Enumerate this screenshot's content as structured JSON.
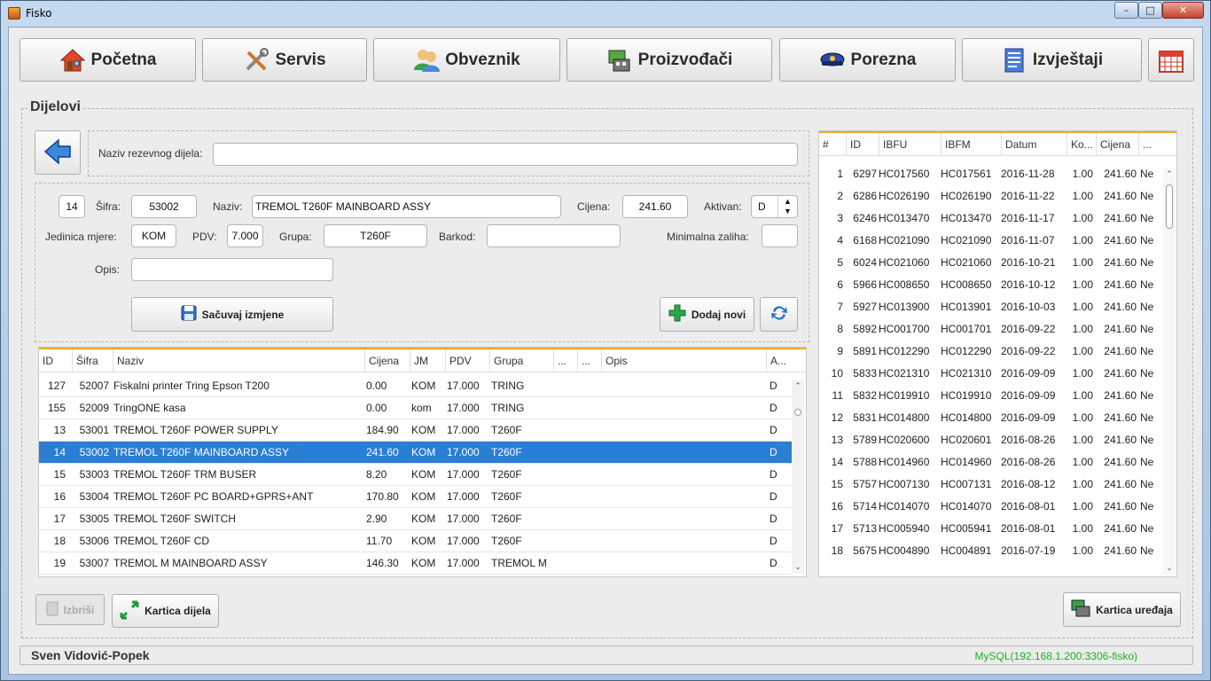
{
  "window": {
    "title": "Fisko",
    "min": "–",
    "max": "□",
    "close": "✕"
  },
  "nav": [
    {
      "label": "Početna",
      "icon": "home-icon"
    },
    {
      "label": "Servis",
      "icon": "tools-icon"
    },
    {
      "label": "Obveznik",
      "icon": "users-icon"
    },
    {
      "label": "Proizvođači",
      "icon": "factory-icon"
    },
    {
      "label": "Porezna",
      "icon": "police-cap-icon"
    },
    {
      "label": "Izvještaji",
      "icon": "report-icon"
    }
  ],
  "panel_title": "Dijelovi",
  "search": {
    "label": "Naziv rezevnog dijela:",
    "value": ""
  },
  "form": {
    "id": "14",
    "sifra_label": "Šifra:",
    "sifra": "53002",
    "naziv_label": "Naziv:",
    "naziv": "TREMOL T260F MAINBOARD ASSY",
    "cijena_label": "Cijena:",
    "cijena": "241.60",
    "aktivan_label": "Aktivan:",
    "aktivan": "D",
    "jm_label": "Jedinica mjere:",
    "jm": "KOM",
    "pdv_label": "PDV:",
    "pdv": "7.000",
    "grupa_label": "Grupa:",
    "grupa": "T260F",
    "barkod_label": "Barkod:",
    "barkod": "",
    "minzal_label": "Minimalna zaliha:",
    "minzal": "",
    "opis_label": "Opis:",
    "opis": "",
    "save_label": "Sačuvaj izmjene",
    "add_label": "Dodaj novi"
  },
  "parts": {
    "columns": [
      "ID",
      "Šifra",
      "Naziv",
      "Cijena",
      "JM",
      "PDV",
      "Grupa",
      "...",
      "...",
      "Opis",
      "A..."
    ],
    "rows": [
      [
        "127",
        "52007",
        "Fiskalni printer Tring Epson T200",
        "0.00",
        "KOM",
        "17.000",
        "TRING",
        "D"
      ],
      [
        "155",
        "52009",
        "TringONE kasa",
        "0.00",
        "kom",
        "17.000",
        "TRING",
        "D"
      ],
      [
        "13",
        "53001",
        "TREMOL T260F POWER SUPPLY",
        "184.90",
        "KOM",
        "17.000",
        "T260F",
        "D"
      ],
      [
        "14",
        "53002",
        "TREMOL T260F MAINBOARD ASSY",
        "241.60",
        "KOM",
        "17.000",
        "T260F",
        "D"
      ],
      [
        "15",
        "53003",
        "TREMOL T260F TRM BUSER",
        "8.20",
        "KOM",
        "17.000",
        "T260F",
        "D"
      ],
      [
        "16",
        "53004",
        "TREMOL T260F PC BOARD+GPRS+ANT",
        "170.80",
        "KOM",
        "17.000",
        "T260F",
        "D"
      ],
      [
        "17",
        "53005",
        "TREMOL T260F SWITCH",
        "2.90",
        "KOM",
        "17.000",
        "T260F",
        "D"
      ],
      [
        "18",
        "53006",
        "TREMOL T260F CD",
        "11.70",
        "KOM",
        "17.000",
        "T260F",
        "D"
      ],
      [
        "19",
        "53007",
        "TREMOL M MAINBOARD ASSY",
        "146.30",
        "KOM",
        "17.000",
        "TREMOL M",
        "D"
      ]
    ]
  },
  "devices": {
    "columns": [
      "#",
      "ID",
      "IBFU",
      "IBFM",
      "Datum",
      "Ko...",
      "Cijena",
      "..."
    ],
    "rows": [
      [
        "1",
        "6297",
        "HC017560",
        "HC017561",
        "2016-11-28",
        "1.00",
        "241.60",
        "Ne"
      ],
      [
        "2",
        "6286",
        "HC026190",
        "HC026190",
        "2016-11-22",
        "1.00",
        "241.60",
        "Ne"
      ],
      [
        "3",
        "6246",
        "HC013470",
        "HC013470",
        "2016-11-17",
        "1.00",
        "241.60",
        "Ne"
      ],
      [
        "4",
        "6168",
        "HC021090",
        "HC021090",
        "2016-11-07",
        "1.00",
        "241.60",
        "Ne"
      ],
      [
        "5",
        "6024",
        "HC021060",
        "HC021060",
        "2016-10-21",
        "1.00",
        "241.60",
        "Ne"
      ],
      [
        "6",
        "5966",
        "HC008650",
        "HC008650",
        "2016-10-12",
        "1.00",
        "241.60",
        "Ne"
      ],
      [
        "7",
        "5927",
        "HC013900",
        "HC013901",
        "2016-10-03",
        "1.00",
        "241.60",
        "Ne"
      ],
      [
        "8",
        "5892",
        "HC001700",
        "HC001701",
        "2016-09-22",
        "1.00",
        "241.60",
        "Ne"
      ],
      [
        "9",
        "5891",
        "HC012290",
        "HC012290",
        "2016-09-22",
        "1.00",
        "241.60",
        "Ne"
      ],
      [
        "10",
        "5833",
        "HC021310",
        "HC021310",
        "2016-09-09",
        "1.00",
        "241.60",
        "Ne"
      ],
      [
        "11",
        "5832",
        "HC019910",
        "HC019910",
        "2016-09-09",
        "1.00",
        "241.60",
        "Ne"
      ],
      [
        "12",
        "5831",
        "HC014800",
        "HC014800",
        "2016-09-09",
        "1.00",
        "241.60",
        "Ne"
      ],
      [
        "13",
        "5789",
        "HC020600",
        "HC020601",
        "2016-08-26",
        "1.00",
        "241.60",
        "Ne"
      ],
      [
        "14",
        "5788",
        "HC014960",
        "HC014960",
        "2016-08-26",
        "1.00",
        "241.60",
        "Ne"
      ],
      [
        "15",
        "5757",
        "HC007130",
        "HC007131",
        "2016-08-12",
        "1.00",
        "241.60",
        "Ne"
      ],
      [
        "16",
        "5714",
        "HC014070",
        "HC014070",
        "2016-08-01",
        "1.00",
        "241.60",
        "Ne"
      ],
      [
        "17",
        "5713",
        "HC005940",
        "HC005941",
        "2016-08-01",
        "1.00",
        "241.60",
        "Ne"
      ],
      [
        "18",
        "5675",
        "HC004890",
        "HC004891",
        "2016-07-19",
        "1.00",
        "241.60",
        "Ne"
      ]
    ]
  },
  "bottom": {
    "delete_label": "Izbriši",
    "card_part_label": "Kartica dijela",
    "card_device_label": "Kartica uređaja"
  },
  "status": {
    "user": "Sven Vidović-Popek",
    "db": "MySQL(192.168.1.200:3306-fisko)"
  },
  "colors": {
    "selection": "#2a7ed6",
    "accent": "#f5a623",
    "db_status": "#18b418"
  }
}
